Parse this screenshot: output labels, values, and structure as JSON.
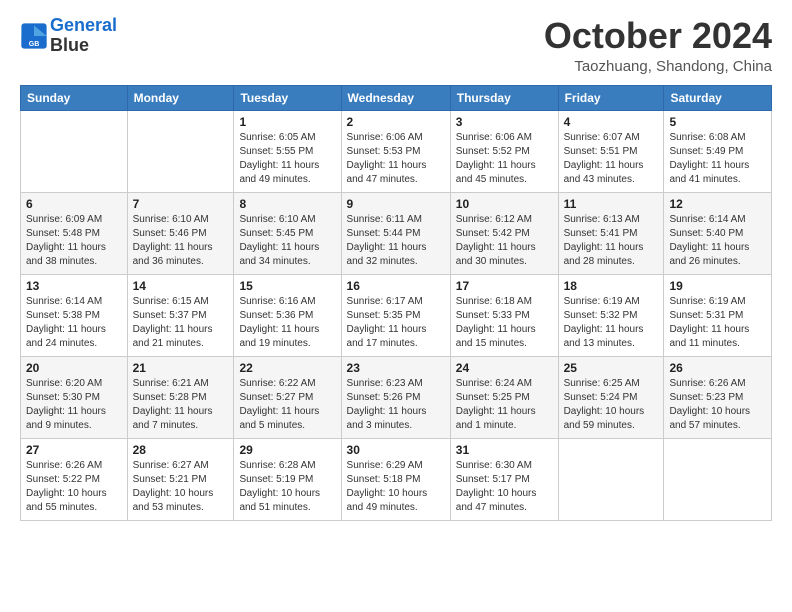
{
  "header": {
    "logo": {
      "line1": "General",
      "line2": "Blue"
    },
    "title": "October 2024",
    "location": "Taozhuang, Shandong, China"
  },
  "weekdays": [
    "Sunday",
    "Monday",
    "Tuesday",
    "Wednesday",
    "Thursday",
    "Friday",
    "Saturday"
  ],
  "weeks": [
    [
      {
        "day": "",
        "info": ""
      },
      {
        "day": "",
        "info": ""
      },
      {
        "day": "1",
        "info": "Sunrise: 6:05 AM\nSunset: 5:55 PM\nDaylight: 11 hours and 49 minutes."
      },
      {
        "day": "2",
        "info": "Sunrise: 6:06 AM\nSunset: 5:53 PM\nDaylight: 11 hours and 47 minutes."
      },
      {
        "day": "3",
        "info": "Sunrise: 6:06 AM\nSunset: 5:52 PM\nDaylight: 11 hours and 45 minutes."
      },
      {
        "day": "4",
        "info": "Sunrise: 6:07 AM\nSunset: 5:51 PM\nDaylight: 11 hours and 43 minutes."
      },
      {
        "day": "5",
        "info": "Sunrise: 6:08 AM\nSunset: 5:49 PM\nDaylight: 11 hours and 41 minutes."
      }
    ],
    [
      {
        "day": "6",
        "info": "Sunrise: 6:09 AM\nSunset: 5:48 PM\nDaylight: 11 hours and 38 minutes."
      },
      {
        "day": "7",
        "info": "Sunrise: 6:10 AM\nSunset: 5:46 PM\nDaylight: 11 hours and 36 minutes."
      },
      {
        "day": "8",
        "info": "Sunrise: 6:10 AM\nSunset: 5:45 PM\nDaylight: 11 hours and 34 minutes."
      },
      {
        "day": "9",
        "info": "Sunrise: 6:11 AM\nSunset: 5:44 PM\nDaylight: 11 hours and 32 minutes."
      },
      {
        "day": "10",
        "info": "Sunrise: 6:12 AM\nSunset: 5:42 PM\nDaylight: 11 hours and 30 minutes."
      },
      {
        "day": "11",
        "info": "Sunrise: 6:13 AM\nSunset: 5:41 PM\nDaylight: 11 hours and 28 minutes."
      },
      {
        "day": "12",
        "info": "Sunrise: 6:14 AM\nSunset: 5:40 PM\nDaylight: 11 hours and 26 minutes."
      }
    ],
    [
      {
        "day": "13",
        "info": "Sunrise: 6:14 AM\nSunset: 5:38 PM\nDaylight: 11 hours and 24 minutes."
      },
      {
        "day": "14",
        "info": "Sunrise: 6:15 AM\nSunset: 5:37 PM\nDaylight: 11 hours and 21 minutes."
      },
      {
        "day": "15",
        "info": "Sunrise: 6:16 AM\nSunset: 5:36 PM\nDaylight: 11 hours and 19 minutes."
      },
      {
        "day": "16",
        "info": "Sunrise: 6:17 AM\nSunset: 5:35 PM\nDaylight: 11 hours and 17 minutes."
      },
      {
        "day": "17",
        "info": "Sunrise: 6:18 AM\nSunset: 5:33 PM\nDaylight: 11 hours and 15 minutes."
      },
      {
        "day": "18",
        "info": "Sunrise: 6:19 AM\nSunset: 5:32 PM\nDaylight: 11 hours and 13 minutes."
      },
      {
        "day": "19",
        "info": "Sunrise: 6:19 AM\nSunset: 5:31 PM\nDaylight: 11 hours and 11 minutes."
      }
    ],
    [
      {
        "day": "20",
        "info": "Sunrise: 6:20 AM\nSunset: 5:30 PM\nDaylight: 11 hours and 9 minutes."
      },
      {
        "day": "21",
        "info": "Sunrise: 6:21 AM\nSunset: 5:28 PM\nDaylight: 11 hours and 7 minutes."
      },
      {
        "day": "22",
        "info": "Sunrise: 6:22 AM\nSunset: 5:27 PM\nDaylight: 11 hours and 5 minutes."
      },
      {
        "day": "23",
        "info": "Sunrise: 6:23 AM\nSunset: 5:26 PM\nDaylight: 11 hours and 3 minutes."
      },
      {
        "day": "24",
        "info": "Sunrise: 6:24 AM\nSunset: 5:25 PM\nDaylight: 11 hours and 1 minute."
      },
      {
        "day": "25",
        "info": "Sunrise: 6:25 AM\nSunset: 5:24 PM\nDaylight: 10 hours and 59 minutes."
      },
      {
        "day": "26",
        "info": "Sunrise: 6:26 AM\nSunset: 5:23 PM\nDaylight: 10 hours and 57 minutes."
      }
    ],
    [
      {
        "day": "27",
        "info": "Sunrise: 6:26 AM\nSunset: 5:22 PM\nDaylight: 10 hours and 55 minutes."
      },
      {
        "day": "28",
        "info": "Sunrise: 6:27 AM\nSunset: 5:21 PM\nDaylight: 10 hours and 53 minutes."
      },
      {
        "day": "29",
        "info": "Sunrise: 6:28 AM\nSunset: 5:19 PM\nDaylight: 10 hours and 51 minutes."
      },
      {
        "day": "30",
        "info": "Sunrise: 6:29 AM\nSunset: 5:18 PM\nDaylight: 10 hours and 49 minutes."
      },
      {
        "day": "31",
        "info": "Sunrise: 6:30 AM\nSunset: 5:17 PM\nDaylight: 10 hours and 47 minutes."
      },
      {
        "day": "",
        "info": ""
      },
      {
        "day": "",
        "info": ""
      }
    ]
  ]
}
